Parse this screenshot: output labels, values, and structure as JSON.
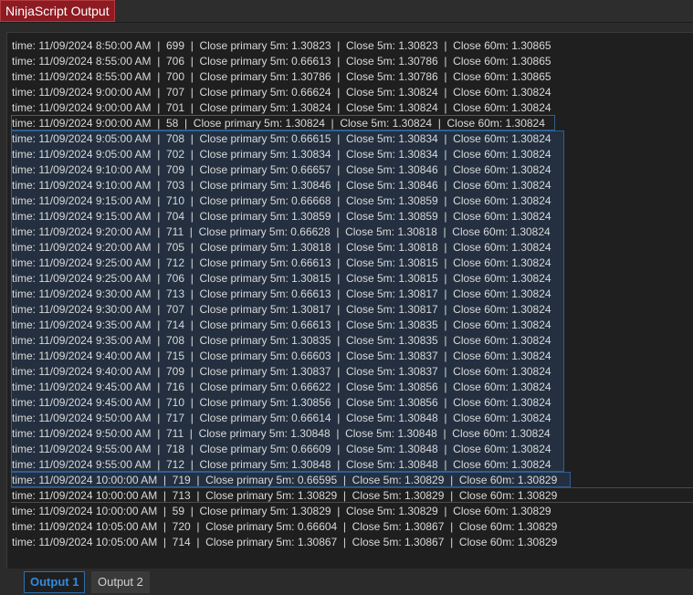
{
  "window": {
    "title": "NinjaScript Output"
  },
  "output": {
    "lines": [
      "time: 11/09/2024 8:50:00 AM  |  699  |  Close primary 5m: 1.30823  |  Close 5m: 1.30823  |  Close 60m: 1.30865",
      "time: 11/09/2024 8:55:00 AM  |  706  |  Close primary 5m: 0.66613  |  Close 5m: 1.30786  |  Close 60m: 1.30865",
      "time: 11/09/2024 8:55:00 AM  |  700  |  Close primary 5m: 1.30786  |  Close 5m: 1.30786  |  Close 60m: 1.30865",
      "time: 11/09/2024 9:00:00 AM  |  707  |  Close primary 5m: 0.66624  |  Close 5m: 1.30824  |  Close 60m: 1.30824",
      "time: 11/09/2024 9:00:00 AM  |  701  |  Close primary 5m: 1.30824  |  Close 5m: 1.30824  |  Close 60m: 1.30824",
      "time: 11/09/2024 9:00:00 AM  |  58  |  Close primary 5m: 1.30824  |  Close 5m: 1.30824  |  Close 60m: 1.30824",
      "time: 11/09/2024 9:05:00 AM  |  708  |  Close primary 5m: 0.66615  |  Close 5m: 1.30834  |  Close 60m: 1.30824",
      "time: 11/09/2024 9:05:00 AM  |  702  |  Close primary 5m: 1.30834  |  Close 5m: 1.30834  |  Close 60m: 1.30824",
      "time: 11/09/2024 9:10:00 AM  |  709  |  Close primary 5m: 0.66657  |  Close 5m: 1.30846  |  Close 60m: 1.30824",
      "time: 11/09/2024 9:10:00 AM  |  703  |  Close primary 5m: 1.30846  |  Close 5m: 1.30846  |  Close 60m: 1.30824",
      "time: 11/09/2024 9:15:00 AM  |  710  |  Close primary 5m: 0.66668  |  Close 5m: 1.30859  |  Close 60m: 1.30824",
      "time: 11/09/2024 9:15:00 AM  |  704  |  Close primary 5m: 1.30859  |  Close 5m: 1.30859  |  Close 60m: 1.30824",
      "time: 11/09/2024 9:20:00 AM  |  711  |  Close primary 5m: 0.66628  |  Close 5m: 1.30818  |  Close 60m: 1.30824",
      "time: 11/09/2024 9:20:00 AM  |  705  |  Close primary 5m: 1.30818  |  Close 5m: 1.30818  |  Close 60m: 1.30824",
      "time: 11/09/2024 9:25:00 AM  |  712  |  Close primary 5m: 0.66613  |  Close 5m: 1.30815  |  Close 60m: 1.30824",
      "time: 11/09/2024 9:25:00 AM  |  706  |  Close primary 5m: 1.30815  |  Close 5m: 1.30815  |  Close 60m: 1.30824",
      "time: 11/09/2024 9:30:00 AM  |  713  |  Close primary 5m: 0.66613  |  Close 5m: 1.30817  |  Close 60m: 1.30824",
      "time: 11/09/2024 9:30:00 AM  |  707  |  Close primary 5m: 1.30817  |  Close 5m: 1.30817  |  Close 60m: 1.30824",
      "time: 11/09/2024 9:35:00 AM  |  714  |  Close primary 5m: 0.66613  |  Close 5m: 1.30835  |  Close 60m: 1.30824",
      "time: 11/09/2024 9:35:00 AM  |  708  |  Close primary 5m: 1.30835  |  Close 5m: 1.30835  |  Close 60m: 1.30824",
      "time: 11/09/2024 9:40:00 AM  |  715  |  Close primary 5m: 0.66603  |  Close 5m: 1.30837  |  Close 60m: 1.30824",
      "time: 11/09/2024 9:40:00 AM  |  709  |  Close primary 5m: 1.30837  |  Close 5m: 1.30837  |  Close 60m: 1.30824",
      "time: 11/09/2024 9:45:00 AM  |  716  |  Close primary 5m: 0.66622  |  Close 5m: 1.30856  |  Close 60m: 1.30824",
      "time: 11/09/2024 9:45:00 AM  |  710  |  Close primary 5m: 1.30856  |  Close 5m: 1.30856  |  Close 60m: 1.30824",
      "time: 11/09/2024 9:50:00 AM  |  717  |  Close primary 5m: 0.66614  |  Close 5m: 1.30848  |  Close 60m: 1.30824",
      "time: 11/09/2024 9:50:00 AM  |  711  |  Close primary 5m: 1.30848  |  Close 5m: 1.30848  |  Close 60m: 1.30824",
      "time: 11/09/2024 9:55:00 AM  |  718  |  Close primary 5m: 0.66609  |  Close 5m: 1.30848  |  Close 60m: 1.30824",
      "time: 11/09/2024 9:55:00 AM  |  712  |  Close primary 5m: 1.30848  |  Close 5m: 1.30848  |  Close 60m: 1.30824",
      "time: 11/09/2024 10:00:00 AM  |  719  |  Close primary 5m: 0.66595  |  Close 5m: 1.30829  |  Close 60m: 1.30829",
      "time: 11/09/2024 10:00:00 AM  |  713  |  Close primary 5m: 1.30829  |  Close 5m: 1.30829  |  Close 60m: 1.30829",
      "time: 11/09/2024 10:00:00 AM  |  59  |  Close primary 5m: 1.30829  |  Close 5m: 1.30829  |  Close 60m: 1.30829",
      "time: 11/09/2024 10:05:00 AM  |  720  |  Close primary 5m: 0.66604  |  Close 5m: 1.30867  |  Close 60m: 1.30829",
      "time: 11/09/2024 10:05:00 AM  |  714  |  Close primary 5m: 1.30867  |  Close 5m: 1.30867  |  Close 60m: 1.30829"
    ]
  },
  "tabs": [
    {
      "label": "Output 1",
      "active": true
    },
    {
      "label": "Output 2",
      "active": false
    }
  ],
  "colors": {
    "title_tab_bg": "#8e1b22",
    "active_tab_text": "#2f8be0",
    "selection_border": "#2f5f94",
    "text": "#d9d9d9"
  }
}
